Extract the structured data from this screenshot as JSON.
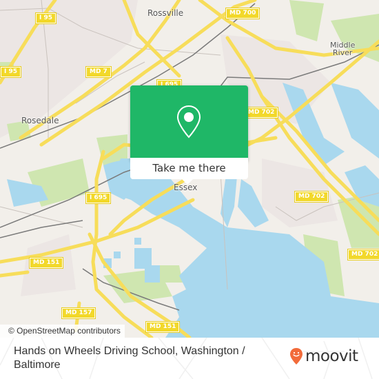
{
  "map": {
    "places": [
      {
        "id": "rossville",
        "name": "Rossville"
      },
      {
        "id": "middle-river",
        "name": "Middle\nRiver"
      },
      {
        "id": "rosedale",
        "name": "Rosedale"
      },
      {
        "id": "essex",
        "name": "Essex"
      }
    ],
    "road_shields": [
      {
        "id": "i95-top",
        "label": "I 95"
      },
      {
        "id": "i95-left",
        "label": "I 95"
      },
      {
        "id": "md7",
        "label": "MD 7"
      },
      {
        "id": "md700",
        "label": "MD 700"
      },
      {
        "id": "i695-top",
        "label": "I 695"
      },
      {
        "id": "md702-top",
        "label": "MD 702"
      },
      {
        "id": "i695-mid",
        "label": "I 695"
      },
      {
        "id": "md702-mid",
        "label": "MD 702"
      },
      {
        "id": "md702-right",
        "label": "MD 702"
      },
      {
        "id": "md151-left",
        "label": "MD 151"
      },
      {
        "id": "md157",
        "label": "MD 157"
      },
      {
        "id": "md151-bottom",
        "label": "MD 151"
      }
    ],
    "attribution": "© OpenStreetMap contributors",
    "colors": {
      "land": "#f2efea",
      "water": "#a9d8ee",
      "park": "#cfe6b0",
      "road": "#f7dd5a",
      "rail": "#777777"
    }
  },
  "popup": {
    "icon": "map-pin-icon",
    "button_label": "Take me there",
    "color": "#1fb767"
  },
  "footer": {
    "title": "Hands on Wheels Driving School, Washington / Baltimore",
    "logo_text": "moovit",
    "logo_icon": "moovit-smiley-pin-icon",
    "logo_color": "#f26b3a"
  }
}
